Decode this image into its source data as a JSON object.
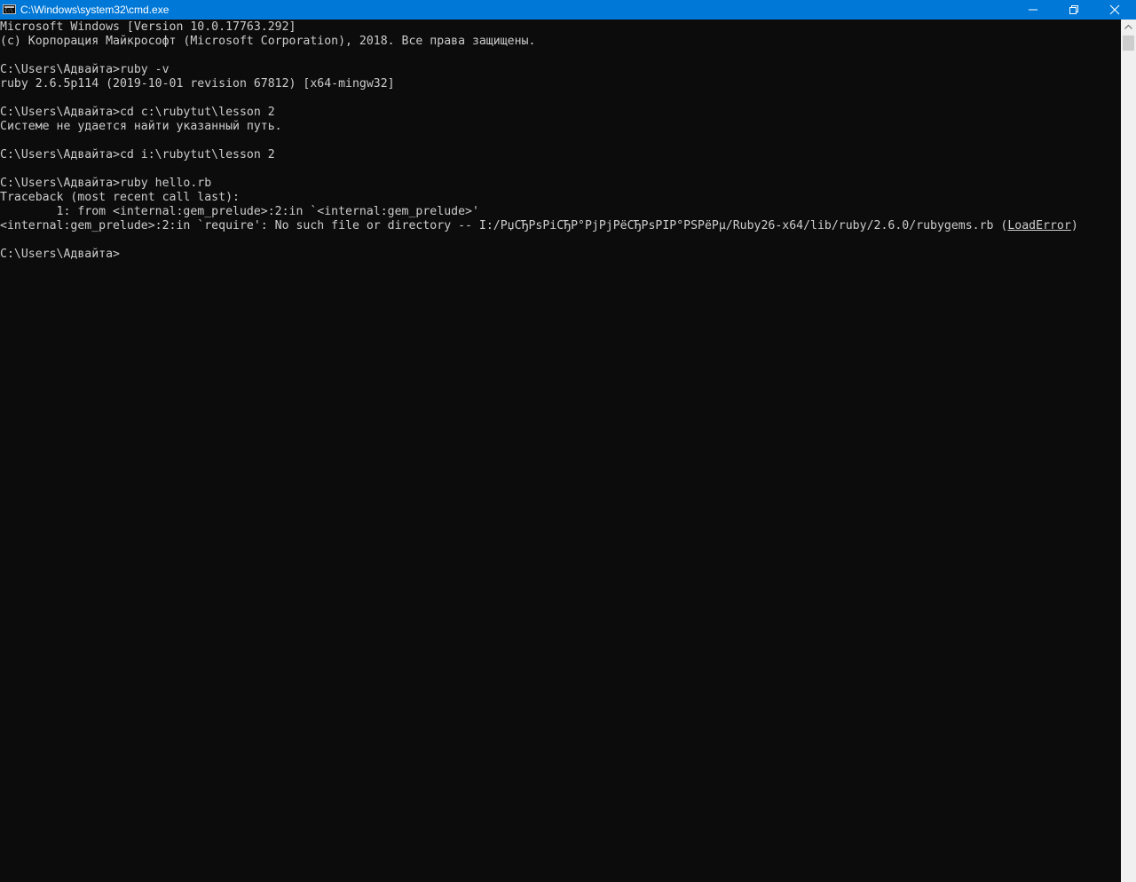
{
  "window": {
    "title": "C:\\Windows\\system32\\cmd.exe",
    "icon": "console-app-icon",
    "accent_color": "#0078d7",
    "controls": {
      "minimize_icon": "minimize-icon",
      "maximize_icon": "restore-icon",
      "close_icon": "close-icon"
    }
  },
  "console": {
    "background": "#0c0c0c",
    "foreground": "#cccccc",
    "lines": [
      {
        "text": "Microsoft Windows [Version 10.0.17763.292]"
      },
      {
        "text": "(c) Корпорация Майкрософт (Microsoft Corporation), 2018. Все права защищены."
      },
      {
        "text": ""
      },
      {
        "text": "C:\\Users\\Адвайта>ruby -v"
      },
      {
        "text": "ruby 2.6.5p114 (2019-10-01 revision 67812) [x64-mingw32]"
      },
      {
        "text": ""
      },
      {
        "text": "C:\\Users\\Адвайта>cd c:\\rubytut\\lesson 2"
      },
      {
        "text": "Системе не удается найти указанный путь."
      },
      {
        "text": ""
      },
      {
        "text": "C:\\Users\\Адвайта>cd i:\\rubytut\\lesson 2"
      },
      {
        "text": ""
      },
      {
        "text": "C:\\Users\\Адвайта>ruby hello.rb"
      },
      {
        "text": "Traceback (most recent call last):"
      },
      {
        "text": "        1: from <internal:gem_prelude>:2:in `<internal:gem_prelude>'"
      },
      {
        "text": "<internal:gem_prelude>:2:in `require': No such file or directory -- I:/РџСЂРѕРіСЂР°РјРјРёСЂРѕРІР°РЅРёРµ/Ruby26-x64/lib/ruby/2.6.0/rubygems.rb (",
        "underlined": "LoadError",
        "after": ")"
      },
      {
        "text": ""
      },
      {
        "text": "C:\\Users\\Адвайта>"
      }
    ]
  }
}
